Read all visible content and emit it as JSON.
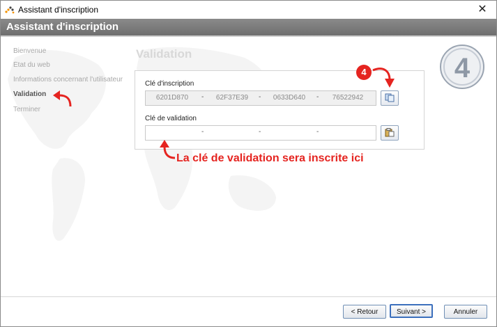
{
  "window": {
    "title": "Assistant d'inscription",
    "close_glyph": "✕"
  },
  "header": {
    "title": "Assistant d'inscription"
  },
  "sidebar": {
    "items": [
      {
        "label": "Bienvenue",
        "active": false
      },
      {
        "label": "État du web",
        "active": false
      },
      {
        "label": "Informations concernant l'utilisateur",
        "active": false
      },
      {
        "label": "Validation",
        "active": true
      },
      {
        "label": "Terminer",
        "active": false
      }
    ]
  },
  "page": {
    "title": "Validation",
    "step_number": "4"
  },
  "registration_key": {
    "label": "Clé d'inscription",
    "segments": [
      "6201D870",
      "62F37E39",
      "0633D640",
      "76522942"
    ],
    "separator": "-",
    "button_icon": "copy-icon"
  },
  "validation_key": {
    "label": "Clé de validation",
    "segments": [
      "",
      "",
      "",
      ""
    ],
    "separator": "-",
    "button_icon": "paste-icon"
  },
  "annotations": {
    "callout_number": "4",
    "callout_text": "La clé de validation sera inscrite ici"
  },
  "buttons": {
    "back": "< Retour",
    "next": "Suivant >",
    "cancel": "Annuler"
  },
  "colors": {
    "header": "#7b7b7b",
    "accent_red": "#e52420",
    "button_border": "#6f8fb5"
  }
}
